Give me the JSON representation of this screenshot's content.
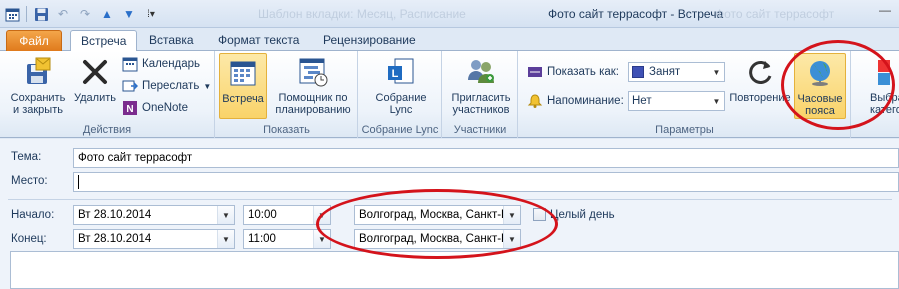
{
  "window": {
    "title": "Фото сайт террасофт - Встреча",
    "ghost_left": "Шаблон вкладки: Месяц, Расписание",
    "ghost_right": "Фото сайт террасофт"
  },
  "quick_access": {
    "icons": [
      "calendar-icon",
      "save-icon",
      "undo-icon",
      "redo-icon",
      "up-arrow-icon",
      "down-arrow-icon",
      "customize-icon"
    ]
  },
  "tabs": [
    {
      "label": "Файл"
    },
    {
      "label": "Встреча"
    },
    {
      "label": "Вставка"
    },
    {
      "label": "Формат текста"
    },
    {
      "label": "Рецензирование"
    }
  ],
  "ribbon": {
    "actions": {
      "group_label": "Действия",
      "save_close": "Сохранить\nи закрыть",
      "delete": "Удалить",
      "calendar": "Календарь",
      "forward": "Переслать",
      "onenote": "OneNote"
    },
    "show": {
      "group_label": "Показать",
      "meeting": "Встреча",
      "scheduling": "Помощник по\nпланированию"
    },
    "lync": {
      "group_label": "Собрание Lync",
      "meeting": "Собрание\nLync"
    },
    "attendees": {
      "group_label": "Участники",
      "invite": "Пригласить\nучастников"
    },
    "options": {
      "group_label": "Параметры",
      "show_as_label": "Показать как:",
      "show_as_value": "Занят",
      "reminder_label": "Напоминание:",
      "reminder_value": "Нет",
      "recurrence": "Повторение",
      "time_zones": "Часовые\nпояса"
    },
    "overflow": {
      "select_category": "Выбрать\nкатегорию"
    }
  },
  "form": {
    "subject_label": "Тема:",
    "subject_value": "Фото сайт террасофт",
    "location_label": "Место:",
    "location_value": "",
    "start_label": "Начало:",
    "start_date": "Вт 28.10.2014",
    "start_time": "10:00",
    "start_tz": "Волгоград, Москва, Санкт-П",
    "all_day_label": "Целый день",
    "end_label": "Конец:",
    "end_date": "Вт 28.10.2014",
    "end_time": "11:00",
    "end_tz": "Волгоград, Москва, Санкт-П"
  },
  "colors": {
    "busy_swatch": "#3f51b5",
    "annotation": "#d4131b",
    "file_tab": "#e07a1c"
  }
}
